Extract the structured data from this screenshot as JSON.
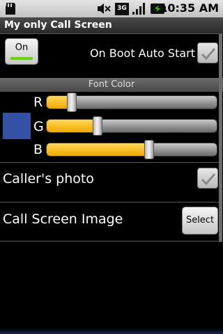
{
  "status_bar": {
    "time": "10:35 AM",
    "icons": [
      "sd-card-icon",
      "muted-speaker-icon",
      "3g-data-icon",
      "signal-icon",
      "battery-charging-icon"
    ],
    "network_label": "3G"
  },
  "title": "My only Call Screen",
  "toggle": {
    "label": "On",
    "active": true,
    "led_color": "#5fd900"
  },
  "on_boot": {
    "label": "On Boot Auto Start",
    "checked": true
  },
  "font_color": {
    "header": "Font Color",
    "swatch_color": "#3551a5",
    "channels": [
      {
        "label": "R",
        "level": 0.15
      },
      {
        "label": "G",
        "level": 0.3
      },
      {
        "label": "B",
        "level": 0.6
      }
    ]
  },
  "callers_photo": {
    "label": "Caller's photo",
    "checked": true
  },
  "call_screen_image": {
    "label": "Call Screen Image",
    "button_label": "Select"
  },
  "colors": {
    "slider_fill": "#f2a800",
    "background": "#000000"
  }
}
